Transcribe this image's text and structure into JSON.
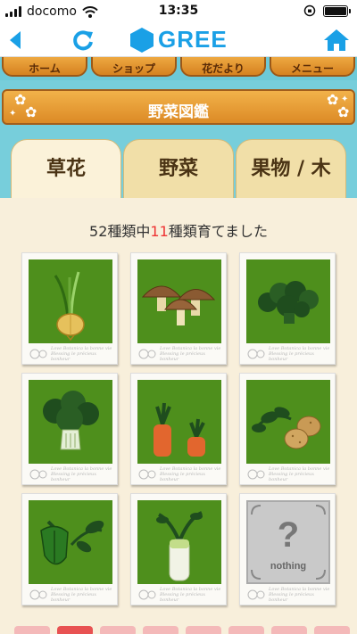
{
  "status_bar": {
    "carrier": "docomo",
    "time": "13:35"
  },
  "nav": {
    "logo_text": "GREE"
  },
  "top_menu": [
    {
      "label": "ホーム"
    },
    {
      "label": "ショップ"
    },
    {
      "label": "花だより"
    },
    {
      "label": "メニュー"
    }
  ],
  "page_title": "野菜図鑑",
  "tabs": [
    {
      "label": "草花",
      "active": true
    },
    {
      "label": "野菜",
      "active": false
    },
    {
      "label": "果物 / 木",
      "active": false
    }
  ],
  "collection": {
    "count_prefix": "52種類中",
    "count_collected": "11",
    "count_suffix": "種類育てました"
  },
  "cards": [
    {
      "item": "onion-icon"
    },
    {
      "item": "mushroom-icon"
    },
    {
      "item": "broccoli-icon"
    },
    {
      "item": "cauliflower-icon"
    },
    {
      "item": "carrot-icon"
    },
    {
      "item": "potato-icon"
    },
    {
      "item": "green-pepper-icon"
    },
    {
      "item": "daikon-icon"
    },
    {
      "item": "unknown-icon",
      "locked_label": "nothing"
    }
  ],
  "card_caption": "Love Botanica la bonne vie Blessing le précieux bonheur",
  "colors": {
    "banner": "#e69a30",
    "sky": "#77cedb",
    "card_green": "#4e8f1c",
    "highlight": "#ee3333",
    "gree_blue": "#1aa0e6"
  }
}
